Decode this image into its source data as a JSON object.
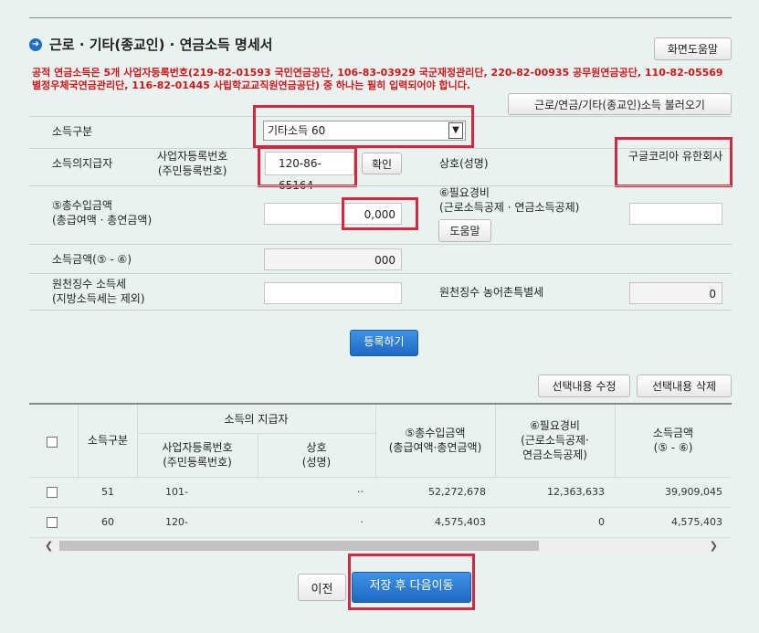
{
  "title": "근로 · 기타(종교인) · 연금소득 명세서",
  "help_button": "화면도움말",
  "notice": "공적 연금소득은 5개 사업자등록번호(219-82-01593 국민연금공단, 106-83-03929 국군재정관리단, 220-82-00935 공무원연금공단, 110-82-05569 별정우체국연금관리단, 116-82-01445 사립학교교직원연금공단) 중 하나는 필히 입력되어야 합니다.",
  "load_button": "근로/연금/기타(종교인)소득 불러오기",
  "form": {
    "income_type_label": "소득구분",
    "income_type_value": "기타소득 60",
    "payer_label": "소득의지급자",
    "bizno_label": "사업자등록번호\n(주민등록번호)",
    "bizno_value": "120-86-65164",
    "confirm_button": "확인",
    "company_label": "상호(성명)",
    "company_value": "구글코리아 유한회사",
    "total_label": "⑤총수입금액\n(총급여액 · 총연금액)",
    "total_value": "0,000",
    "expense_label": "⑥필요경비\n(근로소득공제 · 연금소득공제)",
    "expense_value": "",
    "expense_help_button": "도움말",
    "income_amount_label": "소득금액(⑤ - ⑥)",
    "income_amount_value": "000",
    "withholding_label": "원천징수 소득세\n(지방소득세는 제외)",
    "withholding_value": "",
    "rural_label": "원천징수 농어촌특별세",
    "rural_value": "0"
  },
  "register_button": "등록하기",
  "edit_button": "선택내용 수정",
  "delete_button": "선택내용 삭제",
  "table": {
    "headers": {
      "type": "소득구분",
      "payer": "소득의 지급자",
      "bizno": "사업자등록번호\n(주민등록번호)",
      "name": "상호\n(성명)",
      "total": "⑤총수입금액\n(총급여액·총연금액)",
      "expense": "⑥필요경비\n(근로소득공제·\n연금소득공제)",
      "income": "소득금액\n(⑤ - ⑥)"
    },
    "rows": [
      {
        "type": "51",
        "bizno": "101-",
        "name": "··",
        "total": "52,272,678",
        "expense": "12,363,633",
        "income": "39,909,045"
      },
      {
        "type": "60",
        "bizno": "120-",
        "name": "·",
        "total": "4,575,403",
        "expense": "0",
        "income": "4,575,403"
      }
    ]
  },
  "prev_button": "이전",
  "next_button": "저장 후 다음이동"
}
